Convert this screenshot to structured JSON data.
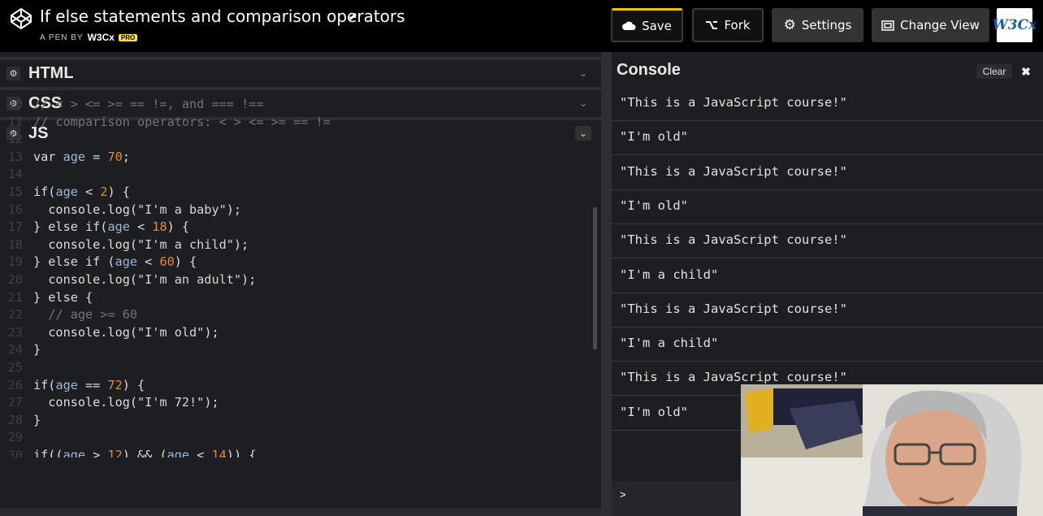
{
  "header": {
    "title": "If else statements and comparison operators",
    "byline_prefix": "A PEN BY",
    "author": "W3Cx",
    "badge": "PRO",
    "buttons": {
      "save": "Save",
      "fork": "Fork",
      "settings": "Settings",
      "change_view": "Change View"
    },
    "logo_text": "W3Cx"
  },
  "editors": {
    "html": "HTML",
    "css": "CSS",
    "js": "JS"
  },
  "code": {
    "lines": [
      {
        "num": "10",
        "text": "// < > <= >= == !=, and === !=="
      },
      {
        "num": "11",
        "text": "// comparison operators: < > <= >= == !="
      },
      {
        "num": "12",
        "text": ""
      },
      {
        "num": "13",
        "text": "var age = 70;"
      },
      {
        "num": "14",
        "text": ""
      },
      {
        "num": "15",
        "text": "if(age < 2) {"
      },
      {
        "num": "16",
        "text": "  console.log(\"I'm a baby\");"
      },
      {
        "num": "17",
        "text": "} else if(age < 18) {"
      },
      {
        "num": "18",
        "text": "  console.log(\"I'm a child\");"
      },
      {
        "num": "19",
        "text": "} else if (age < 60) {"
      },
      {
        "num": "20",
        "text": "  console.log(\"I'm an adult\");"
      },
      {
        "num": "21",
        "text": "} else {"
      },
      {
        "num": "22",
        "text": "  // age >= 60"
      },
      {
        "num": "23",
        "text": "  console.log(\"I'm old\");"
      },
      {
        "num": "24",
        "text": "}"
      },
      {
        "num": "25",
        "text": ""
      },
      {
        "num": "26",
        "text": "if(age == 72) {"
      },
      {
        "num": "27",
        "text": "  console.log(\"I'm 72!\");"
      },
      {
        "num": "28",
        "text": "}"
      },
      {
        "num": "29",
        "text": ""
      },
      {
        "num": "30",
        "text": "if((age > 12) && (age < 14)) {"
      }
    ]
  },
  "console": {
    "title": "Console",
    "clear": "Clear",
    "close": "✖",
    "prompt": ">",
    "output": [
      "\"This is a JavaScript course!\"",
      "\"I'm old\"",
      "\"This is a JavaScript course!\"",
      "\"I'm old\"",
      "\"This is a JavaScript course!\"",
      "\"I'm a child\"",
      "\"This is a JavaScript course!\"",
      "\"I'm a child\"",
      "\"This is a JavaScript course!\"",
      "\"I'm old\""
    ]
  },
  "colors": {
    "accent": "#e8c400",
    "number": "#e08a38",
    "variable": "#9bb8d6",
    "comment": "#717478"
  }
}
